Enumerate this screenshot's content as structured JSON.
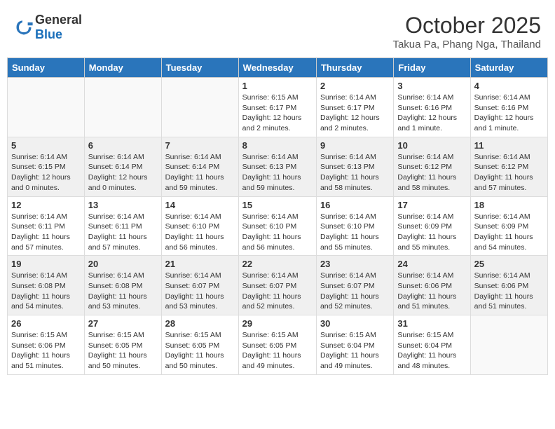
{
  "logo": {
    "general": "General",
    "blue": "Blue"
  },
  "header": {
    "month": "October 2025",
    "location": "Takua Pa, Phang Nga, Thailand"
  },
  "weekdays": [
    "Sunday",
    "Monday",
    "Tuesday",
    "Wednesday",
    "Thursday",
    "Friday",
    "Saturday"
  ],
  "weeks": [
    [
      {
        "day": "",
        "info": ""
      },
      {
        "day": "",
        "info": ""
      },
      {
        "day": "",
        "info": ""
      },
      {
        "day": "1",
        "info": "Sunrise: 6:15 AM\nSunset: 6:17 PM\nDaylight: 12 hours and 2 minutes."
      },
      {
        "day": "2",
        "info": "Sunrise: 6:14 AM\nSunset: 6:17 PM\nDaylight: 12 hours and 2 minutes."
      },
      {
        "day": "3",
        "info": "Sunrise: 6:14 AM\nSunset: 6:16 PM\nDaylight: 12 hours and 1 minute."
      },
      {
        "day": "4",
        "info": "Sunrise: 6:14 AM\nSunset: 6:16 PM\nDaylight: 12 hours and 1 minute."
      }
    ],
    [
      {
        "day": "5",
        "info": "Sunrise: 6:14 AM\nSunset: 6:15 PM\nDaylight: 12 hours and 0 minutes."
      },
      {
        "day": "6",
        "info": "Sunrise: 6:14 AM\nSunset: 6:14 PM\nDaylight: 12 hours and 0 minutes."
      },
      {
        "day": "7",
        "info": "Sunrise: 6:14 AM\nSunset: 6:14 PM\nDaylight: 11 hours and 59 minutes."
      },
      {
        "day": "8",
        "info": "Sunrise: 6:14 AM\nSunset: 6:13 PM\nDaylight: 11 hours and 59 minutes."
      },
      {
        "day": "9",
        "info": "Sunrise: 6:14 AM\nSunset: 6:13 PM\nDaylight: 11 hours and 58 minutes."
      },
      {
        "day": "10",
        "info": "Sunrise: 6:14 AM\nSunset: 6:12 PM\nDaylight: 11 hours and 58 minutes."
      },
      {
        "day": "11",
        "info": "Sunrise: 6:14 AM\nSunset: 6:12 PM\nDaylight: 11 hours and 57 minutes."
      }
    ],
    [
      {
        "day": "12",
        "info": "Sunrise: 6:14 AM\nSunset: 6:11 PM\nDaylight: 11 hours and 57 minutes."
      },
      {
        "day": "13",
        "info": "Sunrise: 6:14 AM\nSunset: 6:11 PM\nDaylight: 11 hours and 57 minutes."
      },
      {
        "day": "14",
        "info": "Sunrise: 6:14 AM\nSunset: 6:10 PM\nDaylight: 11 hours and 56 minutes."
      },
      {
        "day": "15",
        "info": "Sunrise: 6:14 AM\nSunset: 6:10 PM\nDaylight: 11 hours and 56 minutes."
      },
      {
        "day": "16",
        "info": "Sunrise: 6:14 AM\nSunset: 6:10 PM\nDaylight: 11 hours and 55 minutes."
      },
      {
        "day": "17",
        "info": "Sunrise: 6:14 AM\nSunset: 6:09 PM\nDaylight: 11 hours and 55 minutes."
      },
      {
        "day": "18",
        "info": "Sunrise: 6:14 AM\nSunset: 6:09 PM\nDaylight: 11 hours and 54 minutes."
      }
    ],
    [
      {
        "day": "19",
        "info": "Sunrise: 6:14 AM\nSunset: 6:08 PM\nDaylight: 11 hours and 54 minutes."
      },
      {
        "day": "20",
        "info": "Sunrise: 6:14 AM\nSunset: 6:08 PM\nDaylight: 11 hours and 53 minutes."
      },
      {
        "day": "21",
        "info": "Sunrise: 6:14 AM\nSunset: 6:07 PM\nDaylight: 11 hours and 53 minutes."
      },
      {
        "day": "22",
        "info": "Sunrise: 6:14 AM\nSunset: 6:07 PM\nDaylight: 11 hours and 52 minutes."
      },
      {
        "day": "23",
        "info": "Sunrise: 6:14 AM\nSunset: 6:07 PM\nDaylight: 11 hours and 52 minutes."
      },
      {
        "day": "24",
        "info": "Sunrise: 6:14 AM\nSunset: 6:06 PM\nDaylight: 11 hours and 51 minutes."
      },
      {
        "day": "25",
        "info": "Sunrise: 6:14 AM\nSunset: 6:06 PM\nDaylight: 11 hours and 51 minutes."
      }
    ],
    [
      {
        "day": "26",
        "info": "Sunrise: 6:15 AM\nSunset: 6:06 PM\nDaylight: 11 hours and 51 minutes."
      },
      {
        "day": "27",
        "info": "Sunrise: 6:15 AM\nSunset: 6:05 PM\nDaylight: 11 hours and 50 minutes."
      },
      {
        "day": "28",
        "info": "Sunrise: 6:15 AM\nSunset: 6:05 PM\nDaylight: 11 hours and 50 minutes."
      },
      {
        "day": "29",
        "info": "Sunrise: 6:15 AM\nSunset: 6:05 PM\nDaylight: 11 hours and 49 minutes."
      },
      {
        "day": "30",
        "info": "Sunrise: 6:15 AM\nSunset: 6:04 PM\nDaylight: 11 hours and 49 minutes."
      },
      {
        "day": "31",
        "info": "Sunrise: 6:15 AM\nSunset: 6:04 PM\nDaylight: 11 hours and 48 minutes."
      },
      {
        "day": "",
        "info": ""
      }
    ]
  ]
}
